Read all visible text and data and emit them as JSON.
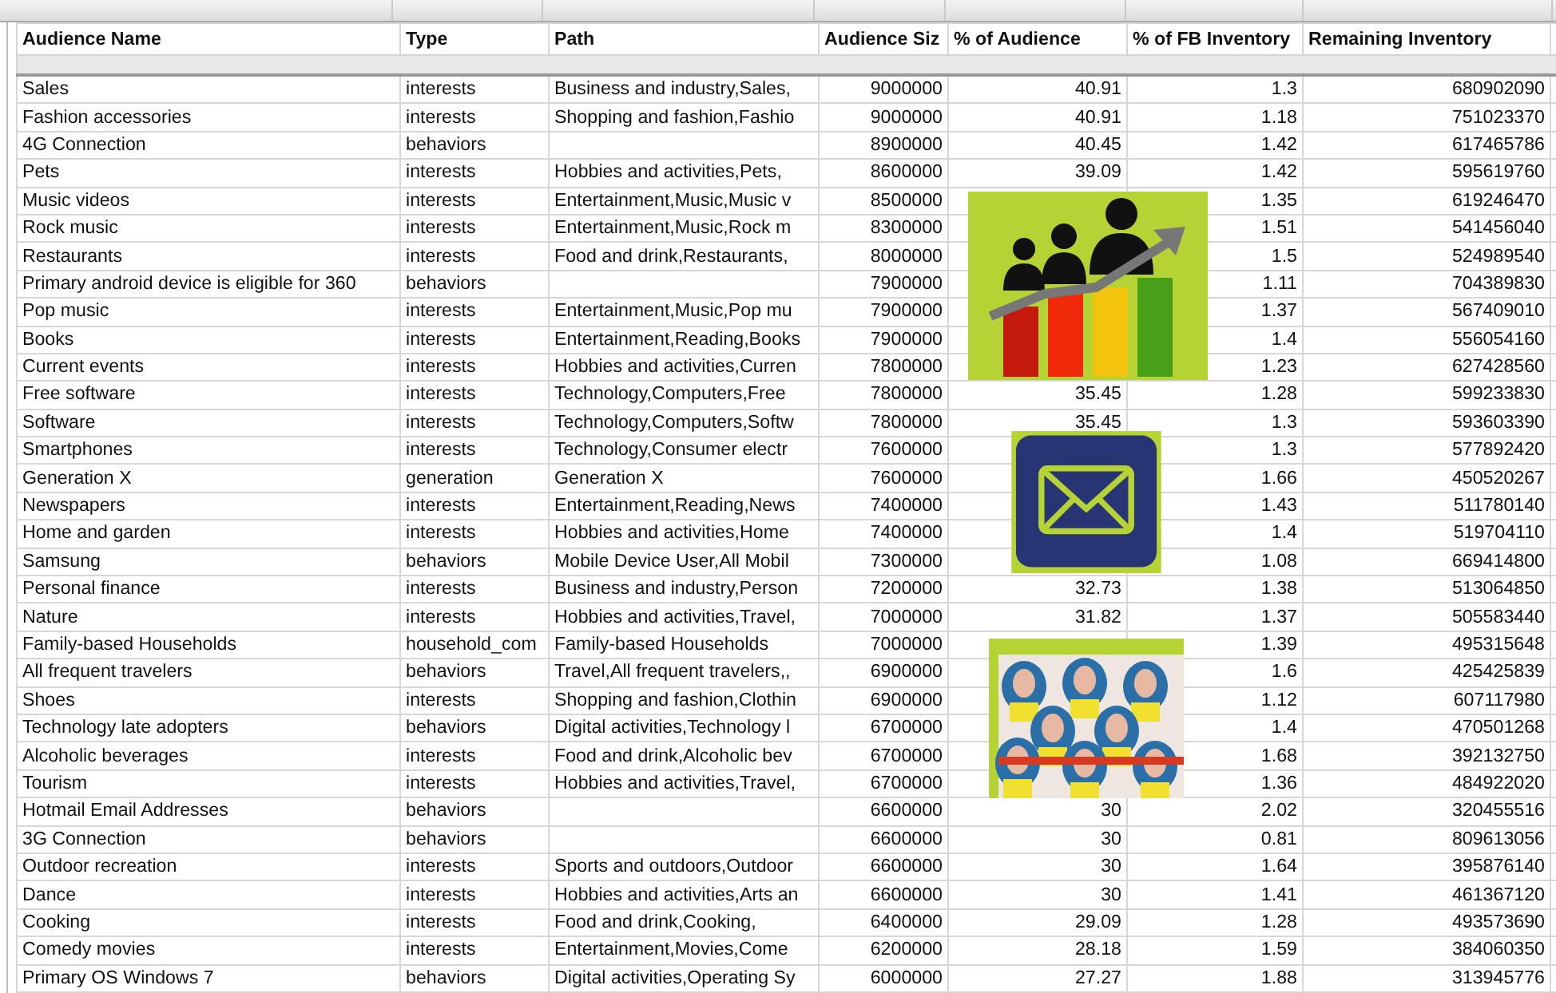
{
  "columns": [
    "Audience Name",
    "Type",
    "Path",
    "Audience Siz",
    "% of Audience",
    "% of FB  Inventory",
    "Remaining Inventory"
  ],
  "rows": [
    {
      "name": "Sales",
      "type": "interests",
      "path": "Business and industry,Sales,",
      "size": "9000000",
      "pct": "40.91",
      "fb": "1.3",
      "remaining": "680902090"
    },
    {
      "name": "Fashion accessories",
      "type": "interests",
      "path": "Shopping and fashion,Fashio",
      "size": "9000000",
      "pct": "40.91",
      "fb": "1.18",
      "remaining": "751023370"
    },
    {
      "name": "4G Connection",
      "type": "behaviors",
      "size": "8900000",
      "pct": "40.45",
      "fb": "1.42",
      "remaining": "617465786"
    },
    {
      "name": "Pets",
      "type": "interests",
      "path": "Hobbies and activities,Pets,",
      "size": "8600000",
      "pct": "39.09",
      "fb": "1.42",
      "remaining": "595619760"
    },
    {
      "name": "Music videos",
      "type": "interests",
      "path": "Entertainment,Music,Music v",
      "size": "8500000",
      "fb": "1.35",
      "remaining": "619246470"
    },
    {
      "name": "Rock music",
      "type": "interests",
      "path": "Entertainment,Music,Rock m",
      "size": "8300000",
      "fb": "1.51",
      "remaining": "541456040"
    },
    {
      "name": "Restaurants",
      "type": "interests",
      "path": "Food and drink,Restaurants,",
      "size": "8000000",
      "fb": "1.5",
      "remaining": "524989540"
    },
    {
      "name": "Primary android device is eligible for 360",
      "type": "behaviors",
      "size": "7900000",
      "fb": "1.11",
      "remaining": "704389830"
    },
    {
      "name": "Pop music",
      "type": "interests",
      "path": "Entertainment,Music,Pop mu",
      "size": "7900000",
      "fb": "1.37",
      "remaining": "567409010"
    },
    {
      "name": "Books",
      "type": "interests",
      "path": "Entertainment,Reading,Books",
      "size": "7900000",
      "fb": "1.4",
      "remaining": "556054160"
    },
    {
      "name": "Current events",
      "type": "interests",
      "path": "Hobbies and activities,Curren",
      "size": "7800000",
      "fb": "1.23",
      "remaining": "627428560"
    },
    {
      "name": "Free software",
      "type": "interests",
      "path": "Technology,Computers,Free",
      "size": "7800000",
      "pct": "35.45",
      "fb": "1.28",
      "remaining": "599233830"
    },
    {
      "name": "Software",
      "type": "interests",
      "path": "Technology,Computers,Softw",
      "size": "7800000",
      "pct": "35.45",
      "fb": "1.3",
      "remaining": "593603390"
    },
    {
      "name": "Smartphones",
      "type": "interests",
      "path": "Technology,Consumer electr",
      "size": "7600000",
      "fb": "1.3",
      "remaining": "577892420"
    },
    {
      "name": "Generation X",
      "type": "generation",
      "path": "Generation X",
      "size": "7600000",
      "fb": "1.66",
      "remaining": "450520267"
    },
    {
      "name": "Newspapers",
      "type": "interests",
      "path": "Entertainment,Reading,News",
      "size": "7400000",
      "fb": "1.43",
      "remaining": "511780140"
    },
    {
      "name": "Home and garden",
      "type": "interests",
      "path": "Hobbies and activities,Home",
      "size": "7400000",
      "fb": "1.4",
      "remaining": "519704110"
    },
    {
      "name": "Samsung",
      "type": "behaviors",
      "path": "Mobile Device User,All Mobil",
      "size": "7300000",
      "fb": "1.08",
      "remaining": "669414800"
    },
    {
      "name": "Personal finance",
      "type": "interests",
      "path": "Business and industry,Person",
      "size": "7200000",
      "pct": "32.73",
      "fb": "1.38",
      "remaining": "513064850"
    },
    {
      "name": "Nature",
      "type": "interests",
      "path": "Hobbies and activities,Travel,",
      "size": "7000000",
      "pct": "31.82",
      "fb": "1.37",
      "remaining": "505583440"
    },
    {
      "name": "Family-based Households",
      "type": "household_com",
      "path": "Family-based Households",
      "size": "7000000",
      "fb": "1.39",
      "remaining": "495315648"
    },
    {
      "name": "All frequent travelers",
      "type": "behaviors",
      "path": "Travel,All frequent travelers,,",
      "size": "6900000",
      "fb": "1.6",
      "remaining": "425425839"
    },
    {
      "name": "Shoes",
      "type": "interests",
      "path": "Shopping and fashion,Clothin",
      "size": "6900000",
      "fb": "1.12",
      "remaining": "607117980"
    },
    {
      "name": "Technology late adopters",
      "type": "behaviors",
      "path": "Digital activities,Technology l",
      "size": "6700000",
      "fb": "1.4",
      "remaining": "470501268"
    },
    {
      "name": "Alcoholic beverages",
      "type": "interests",
      "path": "Food and drink,Alcoholic bev",
      "size": "6700000",
      "fb": "1.68",
      "remaining": "392132750"
    },
    {
      "name": "Tourism",
      "type": "interests",
      "path": "Hobbies and activities,Travel,",
      "size": "6700000",
      "fb": "1.36",
      "remaining": "484922020"
    },
    {
      "name": "Hotmail Email Addresses",
      "type": "behaviors",
      "size": "6600000",
      "pct": "30",
      "fb": "2.02",
      "remaining": "320455516"
    },
    {
      "name": "3G Connection",
      "type": "behaviors",
      "size": "6600000",
      "pct": "30",
      "fb": "0.81",
      "remaining": "809613056"
    },
    {
      "name": "Outdoor recreation",
      "type": "interests",
      "path": "Sports and outdoors,Outdoor",
      "size": "6600000",
      "pct": "30",
      "fb": "1.64",
      "remaining": "395876140"
    },
    {
      "name": "Dance",
      "type": "interests",
      "path": "Hobbies and activities,Arts an",
      "size": "6600000",
      "pct": "30",
      "fb": "1.41",
      "remaining": "461367120"
    },
    {
      "name": "Cooking",
      "type": "interests",
      "path": "Food and drink,Cooking,",
      "size": "6400000",
      "pct": "29.09",
      "fb": "1.28",
      "remaining": "493573690"
    },
    {
      "name": "Comedy movies",
      "type": "interests",
      "path": "Entertainment,Movies,Come",
      "size": "6200000",
      "pct": "28.18",
      "fb": "1.59",
      "remaining": "384060350"
    },
    {
      "name": "Primary OS Windows 7",
      "type": "behaviors",
      "path": "Digital activities,Operating Sy",
      "size": "6000000",
      "pct": "27.27",
      "fb": "1.88",
      "remaining": "313945776"
    }
  ]
}
